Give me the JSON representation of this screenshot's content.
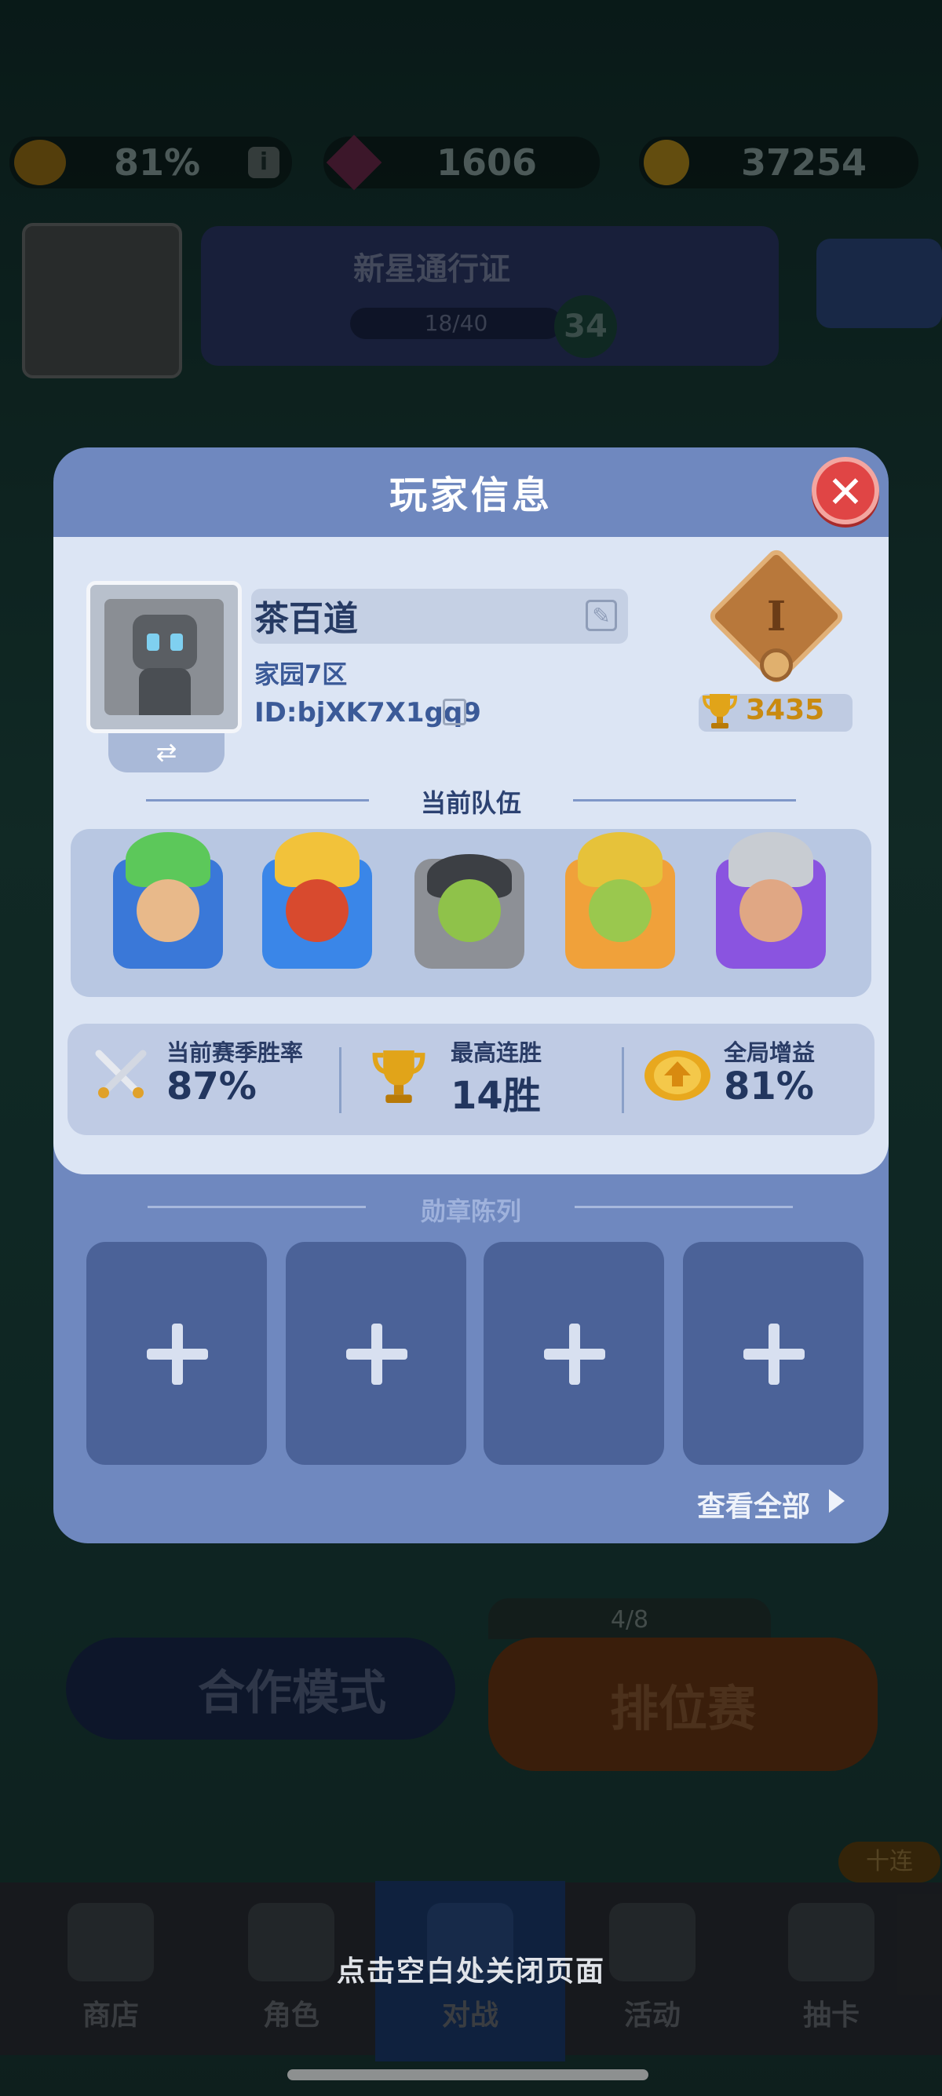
{
  "background": {
    "resources": {
      "boost_percent": "81%",
      "gems": "1606",
      "coins": "37254"
    },
    "pass": {
      "title": "新星通行证",
      "progress": "18/40",
      "level": "34"
    },
    "queue_count": "4/8",
    "modes": {
      "coop": "合作模式",
      "ranked": "排位赛"
    },
    "badge_ten": "十连",
    "nav": {
      "shop": "商店",
      "hero": "角色",
      "battle": "对战",
      "event": "活动",
      "draw": "抽卡"
    }
  },
  "modal": {
    "title": "玩家信息",
    "close_label": "✕",
    "player": {
      "name": "茶百道",
      "region": "家园7区",
      "id": "ID:bjXK7X1gq9",
      "rank_numeral": "I",
      "trophies": "3435"
    },
    "team": {
      "title": "当前队伍",
      "heroes": [
        "broccoli-hero",
        "flame-helmet-hero",
        "goblin-hero",
        "crowned-goblin-hero",
        "knight-hero"
      ]
    },
    "stats": {
      "winrate_label": "当前赛季胜率",
      "winrate_value": "87%",
      "streak_label": "最高连胜",
      "streak_value": "14胜",
      "boost_label": "全局增益",
      "boost_value": "81%"
    },
    "medals": {
      "title": "勋章陈列",
      "view_all": "查看全部"
    }
  },
  "close_hint": "点击空白处关闭页面",
  "colors": {
    "modal_accent": "#6f88bf",
    "modal_inner": "#dce5f4",
    "close_button": "#e04545",
    "trophy_text": "#c98a10"
  }
}
